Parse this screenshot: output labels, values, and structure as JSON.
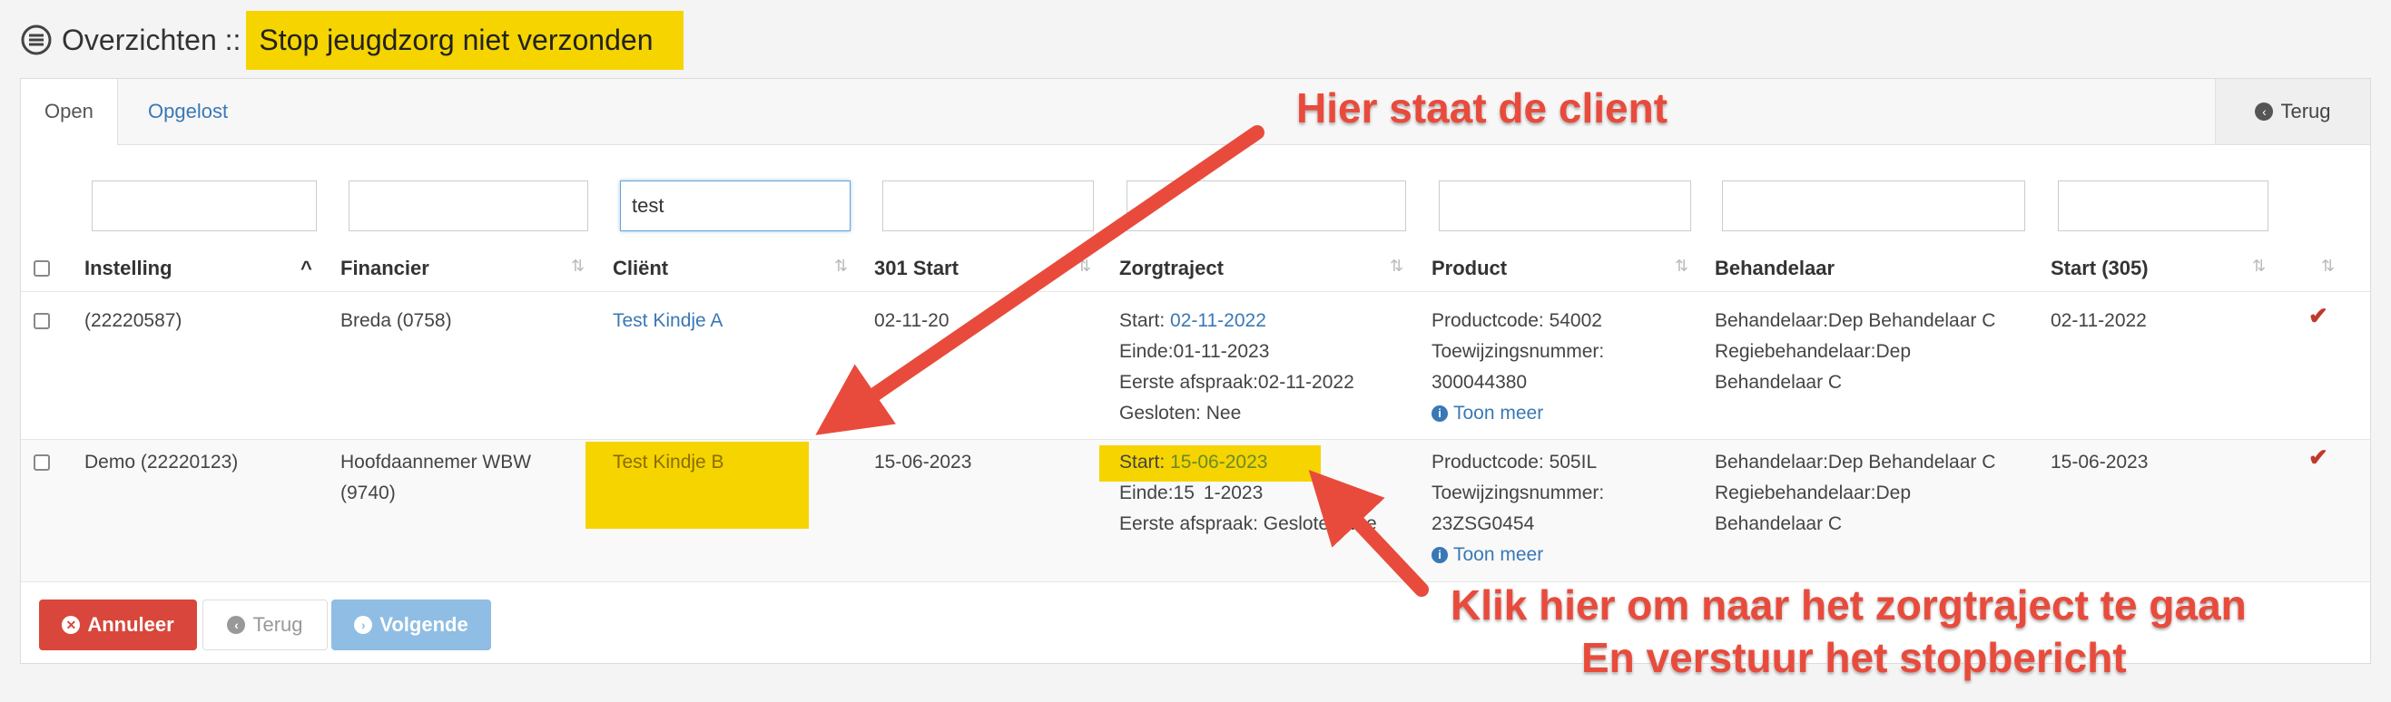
{
  "header": {
    "prefix": "Overzichten ::",
    "highlight": "Stop jeugdzorg niet verzonden",
    "icon": "list-icon"
  },
  "tabs": [
    {
      "label": "Open",
      "active": true
    },
    {
      "label": "Opgelost",
      "active": false
    }
  ],
  "back_tab": {
    "label": "Terug",
    "icon": "back-circle-icon"
  },
  "filters": {
    "client_value": "test"
  },
  "columns": [
    "Instelling",
    "Financier",
    "Cliënt",
    "301 Start",
    "Zorgtraject",
    "Product",
    "Behandelaar",
    "Start (305)"
  ],
  "rows": [
    {
      "instelling": "(22220587)",
      "financier": [
        "Breda (0758)"
      ],
      "client": "Test Kindje A",
      "start301": "02-11-20",
      "zorg_start_label": "Start: ",
      "zorg_start_date": "02-11-2022",
      "zorg_einde": "Einde:01-11-2023",
      "zorg_eerste": "Eerste afspraak:02-11-2022",
      "zorg_gesloten": "Gesloten: Nee",
      "product_code": "Productcode: 54002",
      "product_toew": "Toewijzingsnummer:",
      "product_num": "300044380",
      "toon_meer": "Toon meer",
      "behandelaar": [
        "Behandelaar:Dep Behandelaar C",
        "Regiebehandelaar:Dep",
        "Behandelaar C"
      ],
      "start305": "02-11-2022"
    },
    {
      "instelling": "Demo (22220123)",
      "financier": [
        "Hoofdaannemer WBW",
        "(9740)"
      ],
      "client": "Test Kindje B",
      "start301": "15-06-2023",
      "zorg_start_label": "Start: ",
      "zorg_start_date": "15-06-2023",
      "zorg_einde": "Einde:15",
      "zorg_einde_tail": "1-2023",
      "zorg_eerste": "Eerste afspraak: Geslote",
      "zorg_eerste_tail": "Nee",
      "product_code": "Productcode: 505IL",
      "product_toew": "Toewijzingsnummer:",
      "product_num": "23ZSG0454",
      "toon_meer": "Toon meer",
      "behandelaar": [
        "Behandelaar:Dep Behandelaar C",
        "Regiebehandelaar:Dep",
        "Behandelaar C"
      ],
      "start305": "15-06-2023"
    }
  ],
  "buttons": {
    "annuleer": "Annuleer",
    "terug": "Terug",
    "volgende": "Volgende"
  },
  "annotations": {
    "client": "Hier staat de client",
    "zorg_line1": "Klik hier om naar het zorgtraject te gaan",
    "zorg_line2": "En verstuur het stopbericht"
  },
  "colors": {
    "highlight": "#f5d400",
    "annotation": "#e84b3c",
    "link": "#3a78b5",
    "danger": "#d9463b",
    "primary_disabled": "#8fbde3"
  }
}
